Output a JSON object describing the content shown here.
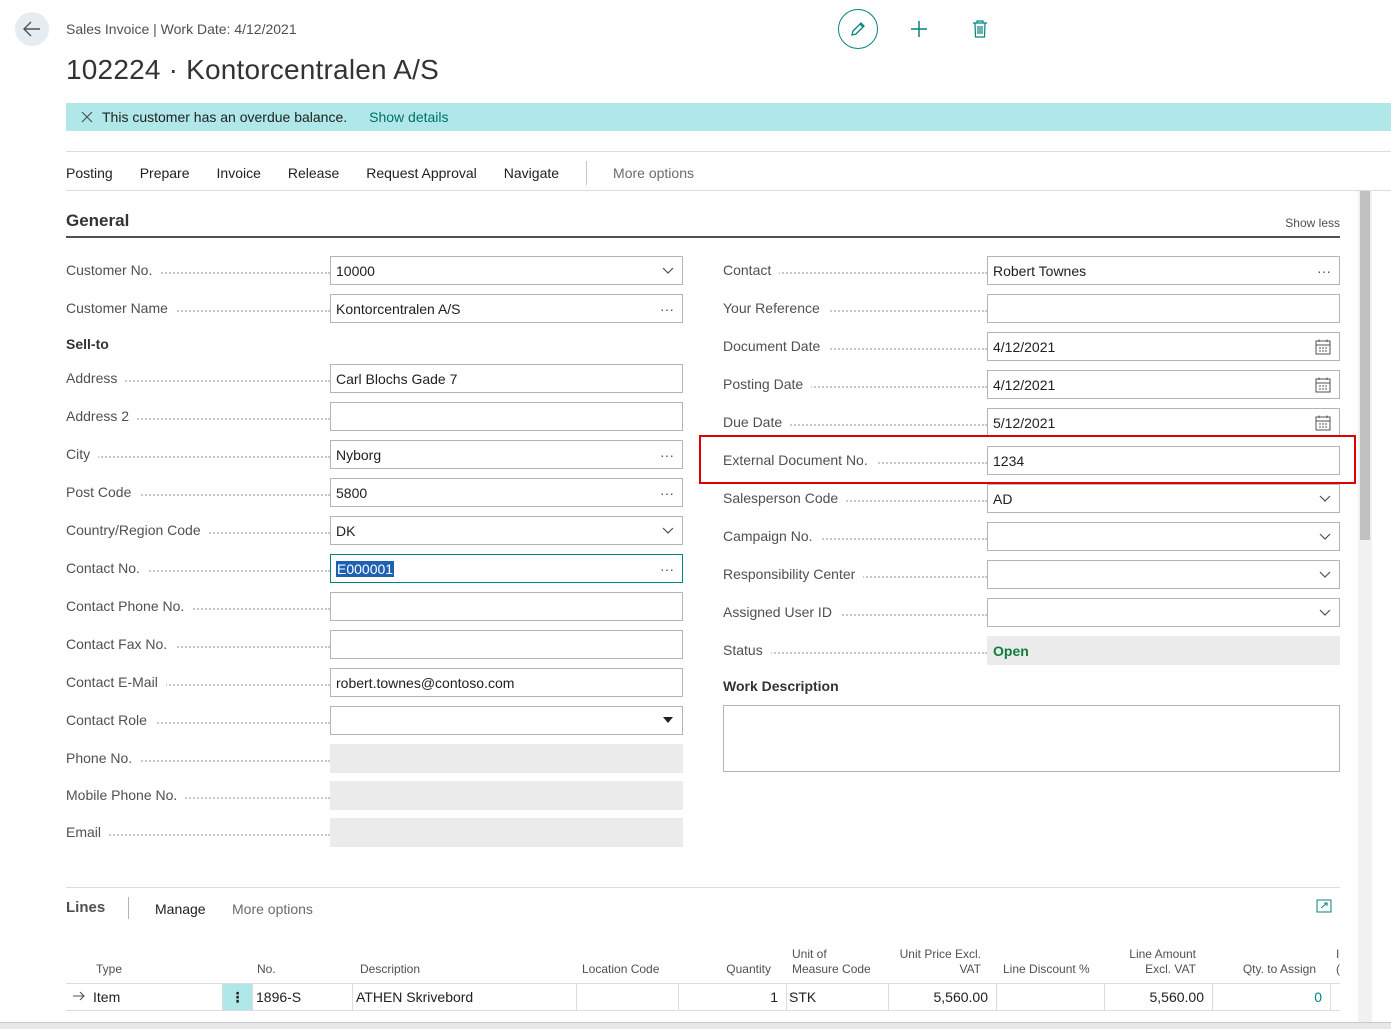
{
  "header": {
    "breadcrumb": "Sales Invoice | Work Date: 4/12/2021",
    "title": "102224 · Kontorcentralen A/S"
  },
  "notification": {
    "message": "This customer has an overdue balance.",
    "link": "Show details"
  },
  "actions": [
    "Posting",
    "Prepare",
    "Invoice",
    "Release",
    "Request Approval",
    "Navigate"
  ],
  "actions_more": "More options",
  "general": {
    "title": "General",
    "show_less": "Show less",
    "customer_no_label": "Customer No.",
    "customer_no": "10000",
    "customer_name_label": "Customer Name",
    "customer_name": "Kontorcentralen A/S",
    "sell_to_heading": "Sell-to",
    "address_label": "Address",
    "address": "Carl Blochs Gade 7",
    "address2_label": "Address 2",
    "address2": "",
    "city_label": "City",
    "city": "Nyborg",
    "post_code_label": "Post Code",
    "post_code": "5800",
    "country_label": "Country/Region Code",
    "country": "DK",
    "contact_no_label": "Contact No.",
    "contact_no": "E000001",
    "contact_phone_label": "Contact Phone No.",
    "contact_phone": "",
    "contact_fax_label": "Contact Fax No.",
    "contact_fax": "",
    "contact_email_label": "Contact E-Mail",
    "contact_email": "robert.townes@contoso.com",
    "contact_role_label": "Contact Role",
    "contact_role": "",
    "phone_label": "Phone No.",
    "mobile_label": "Mobile Phone No.",
    "email_label": "Email",
    "contact_label": "Contact",
    "contact": "Robert Townes",
    "your_ref_label": "Your Reference",
    "your_ref": "",
    "doc_date_label": "Document Date",
    "doc_date": "4/12/2021",
    "posting_date_label": "Posting Date",
    "posting_date": "4/12/2021",
    "due_date_label": "Due Date",
    "due_date": "5/12/2021",
    "ext_doc_label": "External Document No.",
    "ext_doc": "1234",
    "salesperson_label": "Salesperson Code",
    "salesperson": "AD",
    "campaign_label": "Campaign No.",
    "campaign": "",
    "resp_center_label": "Responsibility Center",
    "resp_center": "",
    "assigned_user_label": "Assigned User ID",
    "assigned_user": "",
    "status_label": "Status",
    "status": "Open",
    "work_desc_label": "Work Description"
  },
  "lines": {
    "title": "Lines",
    "manage": "Manage",
    "more": "More options",
    "columns": {
      "type": "Type",
      "no": "No.",
      "description": "Description",
      "location": "Location Code",
      "quantity": "Quantity",
      "uom_1": "Unit of",
      "uom_2": "Measure Code",
      "unit_price_1": "Unit Price Excl.",
      "unit_price_2": "VAT",
      "line_discount": "Line Discount %",
      "line_amount_1": "Line Amount",
      "line_amount_2": "Excl. VAT",
      "qty_assign": "Qty. to Assign",
      "next_1": "I",
      "next_2": "("
    },
    "rows": [
      {
        "type": "Item",
        "no": "1896-S",
        "description": "ATHEN Skrivebord",
        "location": "",
        "quantity": "1",
        "uom": "STK",
        "unit_price": "5,560.00",
        "line_discount": "",
        "line_amount": "5,560.00",
        "qty_assign": "0"
      }
    ]
  },
  "colors": {
    "accent": "#00857d",
    "banner": "#b0e8ea",
    "status_open": "#127c3a",
    "highlight": "#e00000"
  }
}
